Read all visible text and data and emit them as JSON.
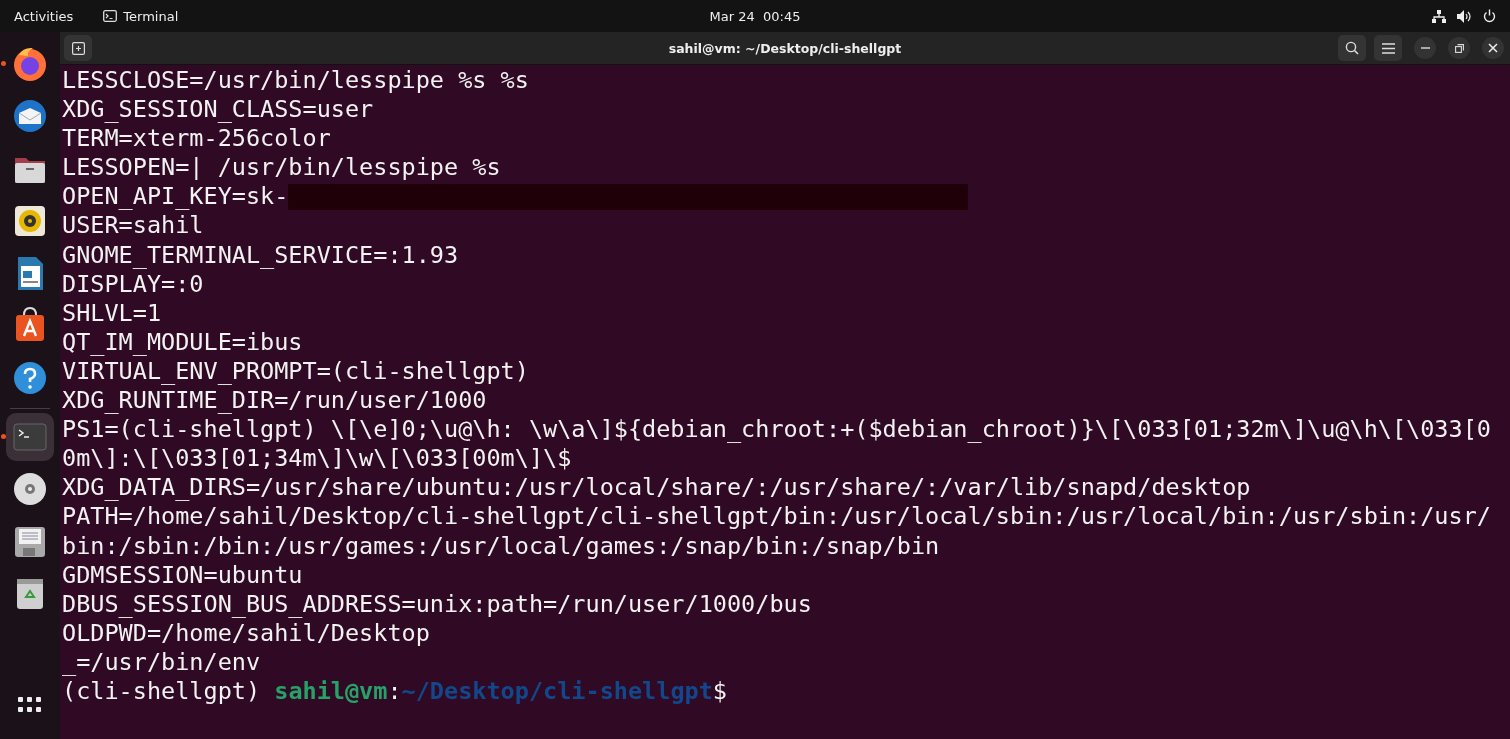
{
  "top_bar": {
    "activities": "Activities",
    "app_name": "Terminal",
    "clock": "Mar 24  00:45"
  },
  "dock": {
    "items": [
      {
        "kind": "firefox",
        "running": true,
        "selected": false
      },
      {
        "kind": "mail",
        "running": false,
        "selected": false
      },
      {
        "kind": "files",
        "running": false,
        "selected": false
      },
      {
        "kind": "music",
        "running": false,
        "selected": false
      },
      {
        "kind": "writer",
        "running": false,
        "selected": false
      },
      {
        "kind": "store",
        "running": false,
        "selected": false
      },
      {
        "kind": "help",
        "running": false,
        "selected": false
      },
      {
        "kind": "terminal",
        "running": true,
        "selected": true
      },
      {
        "kind": "disc",
        "running": false,
        "selected": false
      },
      {
        "kind": "floppy",
        "running": false,
        "selected": false
      },
      {
        "kind": "trash",
        "running": false,
        "selected": false
      }
    ]
  },
  "window": {
    "title": "sahil@vm: ~/Desktop/cli-shellgpt"
  },
  "terminal": {
    "lines": [
      {
        "text": "LESSCLOSE=/usr/bin/lesspipe %s %s"
      },
      {
        "text": "XDG_SESSION_CLASS=user"
      },
      {
        "text": "TERM=xterm-256color"
      },
      {
        "text": "LESSOPEN=| /usr/bin/lesspipe %s"
      },
      {
        "text": "OPEN_API_KEY=sk-",
        "redacted": true
      },
      {
        "text": "USER=sahil"
      },
      {
        "text": "GNOME_TERMINAL_SERVICE=:1.93"
      },
      {
        "text": "DISPLAY=:0"
      },
      {
        "text": "SHLVL=1"
      },
      {
        "text": "QT_IM_MODULE=ibus"
      },
      {
        "text": "VIRTUAL_ENV_PROMPT=(cli-shellgpt)"
      },
      {
        "text": "XDG_RUNTIME_DIR=/run/user/1000"
      },
      {
        "text": "PS1=(cli-shellgpt) \\[\\e]0;\\u@\\h: \\w\\a\\]${debian_chroot:+($debian_chroot)}\\[\\033[01;32m\\]\\u@\\h\\[\\033[0"
      },
      {
        "text": "0m\\]:\\[\\033[01;34m\\]\\w\\[\\033[00m\\]\\$"
      },
      {
        "text": "XDG_DATA_DIRS=/usr/share/ubuntu:/usr/local/share/:/usr/share/:/var/lib/snapd/desktop"
      },
      {
        "text": "PATH=/home/sahil/Desktop/cli-shellgpt/cli-shellgpt/bin:/usr/local/sbin:/usr/local/bin:/usr/sbin:/usr/"
      },
      {
        "text": "bin:/sbin:/bin:/usr/games:/usr/local/games:/snap/bin:/snap/bin"
      },
      {
        "text": "GDMSESSION=ubuntu"
      },
      {
        "text": "DBUS_SESSION_BUS_ADDRESS=unix:path=/run/user/1000/bus"
      },
      {
        "text": "OLDPWD=/home/sahil/Desktop"
      },
      {
        "text": "_=/usr/bin/env"
      }
    ],
    "prompt": [
      {
        "kind": "plain",
        "text": "(cli-shellgpt) "
      },
      {
        "kind": "user",
        "text": "sahil@vm"
      },
      {
        "kind": "plain",
        "text": ":"
      },
      {
        "kind": "path",
        "text": "~/Desktop/cli-shellgpt"
      },
      {
        "kind": "plain",
        "text": "$"
      }
    ]
  }
}
